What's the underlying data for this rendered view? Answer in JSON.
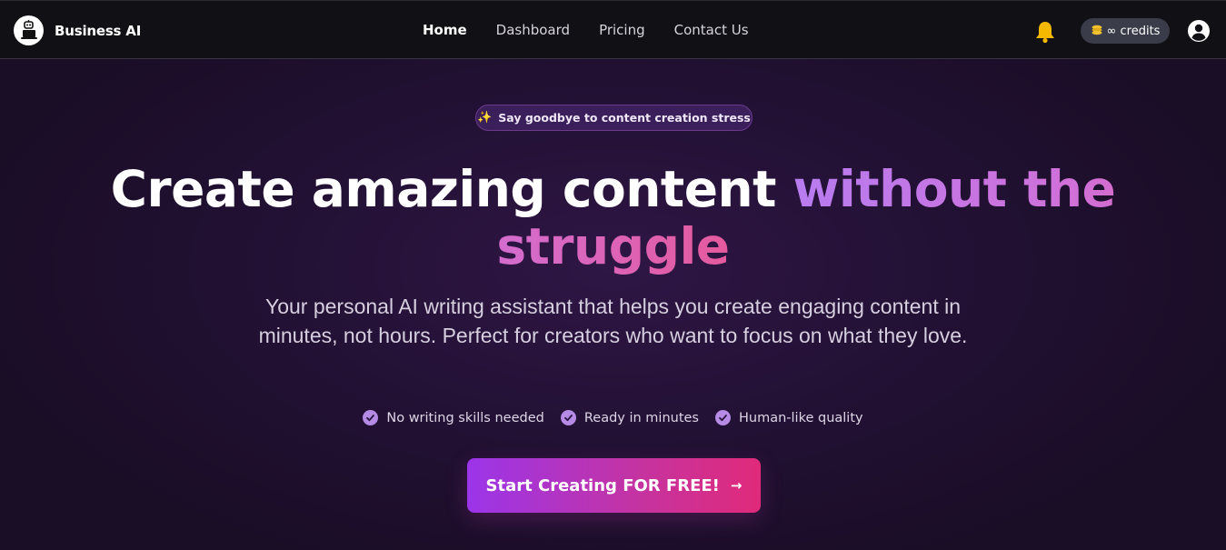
{
  "brand": {
    "name": "Business AI",
    "logo_icon": "robot-laptop-icon"
  },
  "nav": {
    "items": [
      {
        "label": "Home",
        "active": true
      },
      {
        "label": "Dashboard",
        "active": false
      },
      {
        "label": "Pricing",
        "active": false
      },
      {
        "label": "Contact Us",
        "active": false
      }
    ]
  },
  "header_right": {
    "bell_icon": "bell-icon",
    "credits_label": "∞ credits",
    "user_icon": "user-circle-icon"
  },
  "hero": {
    "badge": {
      "icon": "✨",
      "text": "Say goodbye to content creation stress"
    },
    "headline_main": "Create amazing content ",
    "headline_accent": "without the struggle",
    "subtext": "Your personal AI writing assistant that helps you create engaging content in minutes, not hours. Perfect for creators who want to focus on what they love.",
    "features": [
      "No writing skills needed",
      "Ready in minutes",
      "Human-like quality"
    ],
    "cta_label": "Start Creating FOR FREE!",
    "cta_arrow": "→"
  },
  "colors": {
    "nav_bg": "#111014",
    "hero_bg": "#231135",
    "accent_purple": "#b77cf0",
    "accent_pink": "#e55a9e",
    "cta_start": "#9b35ea",
    "cta_end": "#e02a7a",
    "bell": "#f5b800"
  }
}
